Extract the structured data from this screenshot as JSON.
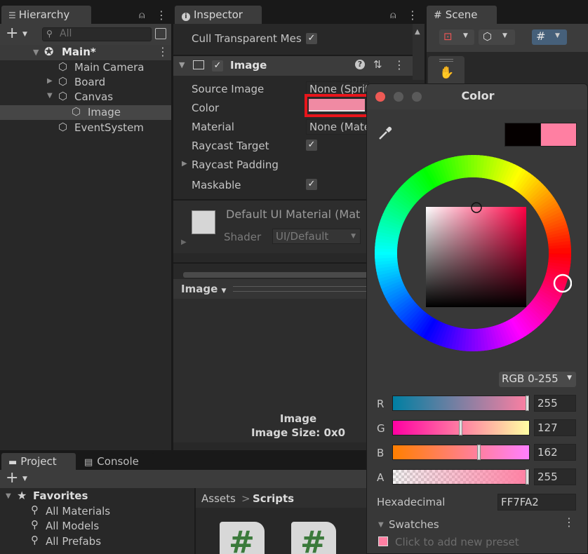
{
  "hierarchy": {
    "tab_label": "Hierarchy",
    "search_placeholder": "All",
    "scene_name": "Main*",
    "items": [
      {
        "label": "Main Camera"
      },
      {
        "label": "Board"
      },
      {
        "label": "Canvas"
      },
      {
        "label": "Image"
      },
      {
        "label": "EventSystem"
      }
    ]
  },
  "inspector": {
    "tab_label": "Inspector",
    "cull_label": "Cull Transparent Mes",
    "component_title": "Image",
    "properties": {
      "source_image_label": "Source Image",
      "source_image_value": "None (Sprit",
      "color_label": "Color",
      "material_label": "Material",
      "material_value": "None (Mate",
      "raycast_target_label": "Raycast Target",
      "raycast_padding_label": "Raycast Padding",
      "maskable_label": "Maskable"
    },
    "material_name": "Default UI Material (Mat",
    "shader_label": "Shader",
    "shader_value": "UI/Default",
    "preview_dropdown": "Image",
    "preview_title": "Image",
    "preview_size": "Image Size: 0x0"
  },
  "scene": {
    "tab_label": "Scene"
  },
  "project": {
    "tab_project": "Project",
    "tab_console": "Console",
    "favorites_label": "Favorites",
    "favorites": [
      {
        "label": "All Materials"
      },
      {
        "label": "All Models"
      },
      {
        "label": "All Prefabs"
      }
    ],
    "breadcrumb_root": "Assets",
    "breadcrumb_sep": ">",
    "breadcrumb_current": "Scripts",
    "script_glyph": "#"
  },
  "color_picker": {
    "title": "Color",
    "mode": "RGB 0-255",
    "channels": [
      {
        "label": "R",
        "value": "255",
        "fraction": 1.0
      },
      {
        "label": "G",
        "value": "127",
        "fraction": 0.498
      },
      {
        "label": "B",
        "value": "162",
        "fraction": 0.635
      },
      {
        "label": "A",
        "value": "255",
        "fraction": 1.0
      }
    ],
    "hex_label": "Hexadecimal",
    "hex_value": "FF7FA2",
    "swatches_label": "Swatches",
    "add_preset_label": "Click to add new preset",
    "previous_color": "#050000",
    "current_color": "#FF7FA2"
  },
  "colors": {
    "accent_selected_row": "#2c5d87",
    "highlight_box": "#e8151b",
    "current_color": "#FF7FA2"
  }
}
